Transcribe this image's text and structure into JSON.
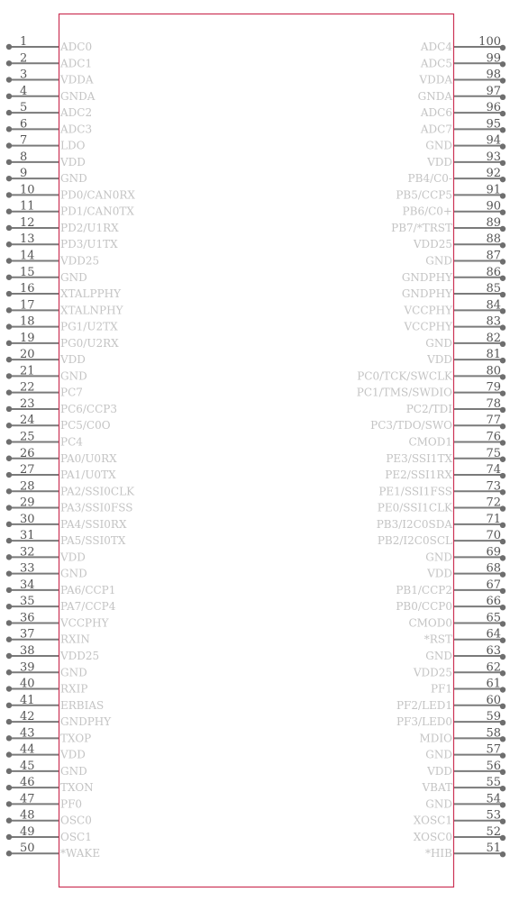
{
  "component": {
    "outline_color": "#cc3355",
    "pin_color": "#7a7a7a",
    "label_color": "#c4c4c4",
    "number_color": "#555555"
  },
  "left_pins": [
    {
      "num": "1",
      "name": "ADC0"
    },
    {
      "num": "2",
      "name": "ADC1"
    },
    {
      "num": "3",
      "name": "VDDA"
    },
    {
      "num": "4",
      "name": "GNDA"
    },
    {
      "num": "5",
      "name": "ADC2"
    },
    {
      "num": "6",
      "name": "ADC3"
    },
    {
      "num": "7",
      "name": "LDO"
    },
    {
      "num": "8",
      "name": "VDD"
    },
    {
      "num": "9",
      "name": "GND"
    },
    {
      "num": "10",
      "name": "PD0/CAN0RX"
    },
    {
      "num": "11",
      "name": "PD1/CAN0TX"
    },
    {
      "num": "12",
      "name": "PD2/U1RX"
    },
    {
      "num": "13",
      "name": "PD3/U1TX"
    },
    {
      "num": "14",
      "name": "VDD25"
    },
    {
      "num": "15",
      "name": "GND"
    },
    {
      "num": "16",
      "name": "XTALPPHY"
    },
    {
      "num": "17",
      "name": "XTALNPHY"
    },
    {
      "num": "18",
      "name": "PG1/U2TX"
    },
    {
      "num": "19",
      "name": "PG0/U2RX"
    },
    {
      "num": "20",
      "name": "VDD"
    },
    {
      "num": "21",
      "name": "GND"
    },
    {
      "num": "22",
      "name": "PC7"
    },
    {
      "num": "23",
      "name": "PC6/CCP3"
    },
    {
      "num": "24",
      "name": "PC5/C0O"
    },
    {
      "num": "25",
      "name": "PC4"
    },
    {
      "num": "26",
      "name": "PA0/U0RX"
    },
    {
      "num": "27",
      "name": "PA1/U0TX"
    },
    {
      "num": "28",
      "name": "PA2/SSI0CLK"
    },
    {
      "num": "29",
      "name": "PA3/SSI0FSS"
    },
    {
      "num": "30",
      "name": "PA4/SSI0RX"
    },
    {
      "num": "31",
      "name": "PA5/SSI0TX"
    },
    {
      "num": "32",
      "name": "VDD"
    },
    {
      "num": "33",
      "name": "GND"
    },
    {
      "num": "34",
      "name": "PA6/CCP1"
    },
    {
      "num": "35",
      "name": "PA7/CCP4"
    },
    {
      "num": "36",
      "name": "VCCPHY"
    },
    {
      "num": "37",
      "name": "RXIN"
    },
    {
      "num": "38",
      "name": "VDD25"
    },
    {
      "num": "39",
      "name": "GND"
    },
    {
      "num": "40",
      "name": "RXIP"
    },
    {
      "num": "41",
      "name": "ERBIAS"
    },
    {
      "num": "42",
      "name": "GNDPHY"
    },
    {
      "num": "43",
      "name": "TXOP"
    },
    {
      "num": "44",
      "name": "VDD"
    },
    {
      "num": "45",
      "name": "GND"
    },
    {
      "num": "46",
      "name": "TXON"
    },
    {
      "num": "47",
      "name": "PF0"
    },
    {
      "num": "48",
      "name": "OSC0"
    },
    {
      "num": "49",
      "name": "OSC1"
    },
    {
      "num": "50",
      "name": "*WAKE"
    }
  ],
  "right_pins": [
    {
      "num": "100",
      "name": "ADC4"
    },
    {
      "num": "99",
      "name": "ADC5"
    },
    {
      "num": "98",
      "name": "VDDA"
    },
    {
      "num": "97",
      "name": "GNDA"
    },
    {
      "num": "96",
      "name": "ADC6"
    },
    {
      "num": "95",
      "name": "ADC7"
    },
    {
      "num": "94",
      "name": "GND"
    },
    {
      "num": "93",
      "name": "VDD"
    },
    {
      "num": "92",
      "name": "PB4/C0-"
    },
    {
      "num": "91",
      "name": "PB5/CCP5"
    },
    {
      "num": "90",
      "name": "PB6/C0+"
    },
    {
      "num": "89",
      "name": "PB7/*TRST"
    },
    {
      "num": "88",
      "name": "VDD25"
    },
    {
      "num": "87",
      "name": "GND"
    },
    {
      "num": "86",
      "name": "GNDPHY"
    },
    {
      "num": "85",
      "name": "GNDPHY"
    },
    {
      "num": "84",
      "name": "VCCPHY"
    },
    {
      "num": "83",
      "name": "VCCPHY"
    },
    {
      "num": "82",
      "name": "GND"
    },
    {
      "num": "81",
      "name": "VDD"
    },
    {
      "num": "80",
      "name": "PC0/TCK/SWCLK"
    },
    {
      "num": "79",
      "name": "PC1/TMS/SWDIO"
    },
    {
      "num": "78",
      "name": "PC2/TDI"
    },
    {
      "num": "77",
      "name": "PC3/TDO/SWO"
    },
    {
      "num": "76",
      "name": "CMOD1"
    },
    {
      "num": "75",
      "name": "PE3/SSI1TX"
    },
    {
      "num": "74",
      "name": "PE2/SSI1RX"
    },
    {
      "num": "73",
      "name": "PE1/SSI1FSS"
    },
    {
      "num": "72",
      "name": "PE0/SSI1CLK"
    },
    {
      "num": "71",
      "name": "PB3/I2C0SDA"
    },
    {
      "num": "70",
      "name": "PB2/I2C0SCL"
    },
    {
      "num": "69",
      "name": "GND"
    },
    {
      "num": "68",
      "name": "VDD"
    },
    {
      "num": "67",
      "name": "PB1/CCP2"
    },
    {
      "num": "66",
      "name": "PB0/CCP0"
    },
    {
      "num": "65",
      "name": "CMOD0"
    },
    {
      "num": "64",
      "name": "*RST"
    },
    {
      "num": "63",
      "name": "GND"
    },
    {
      "num": "62",
      "name": "VDD25"
    },
    {
      "num": "61",
      "name": "PF1"
    },
    {
      "num": "60",
      "name": "PF2/LED1"
    },
    {
      "num": "59",
      "name": "PF3/LED0"
    },
    {
      "num": "58",
      "name": "MDIO"
    },
    {
      "num": "57",
      "name": "GND"
    },
    {
      "num": "56",
      "name": "VDD"
    },
    {
      "num": "55",
      "name": "VBAT"
    },
    {
      "num": "54",
      "name": "GND"
    },
    {
      "num": "53",
      "name": "XOSC1"
    },
    {
      "num": "52",
      "name": "XOSC0"
    },
    {
      "num": "51",
      "name": "*HIB"
    }
  ]
}
